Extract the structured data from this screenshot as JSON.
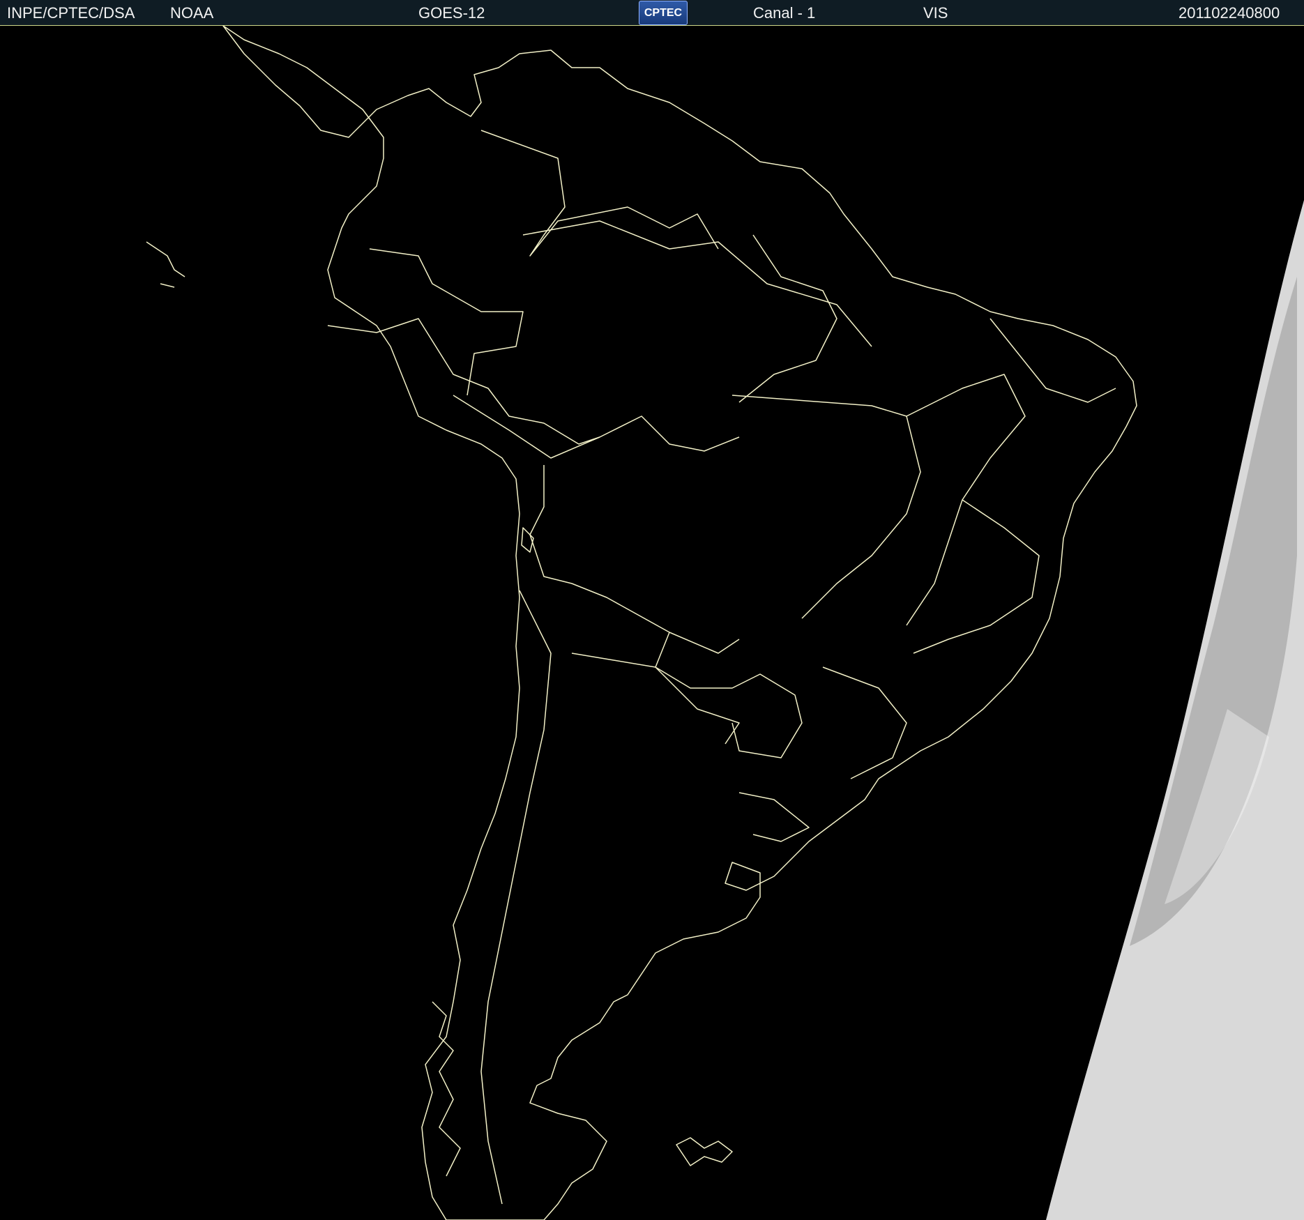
{
  "header": {
    "agency": "INPE/CPTEC/DSA",
    "provider": "NOAA",
    "satellite": "GOES-12",
    "logo_text": "CPTEC",
    "channel": "Canal - 1",
    "band": "VIS",
    "timestamp": "201102240800"
  },
  "colors": {
    "background": "#000000",
    "header_bg": "#0f1c24",
    "coastline": "#f3f1c8",
    "clouds": "#d9d9d9"
  },
  "icons": {
    "logo": "cptec-logo"
  }
}
